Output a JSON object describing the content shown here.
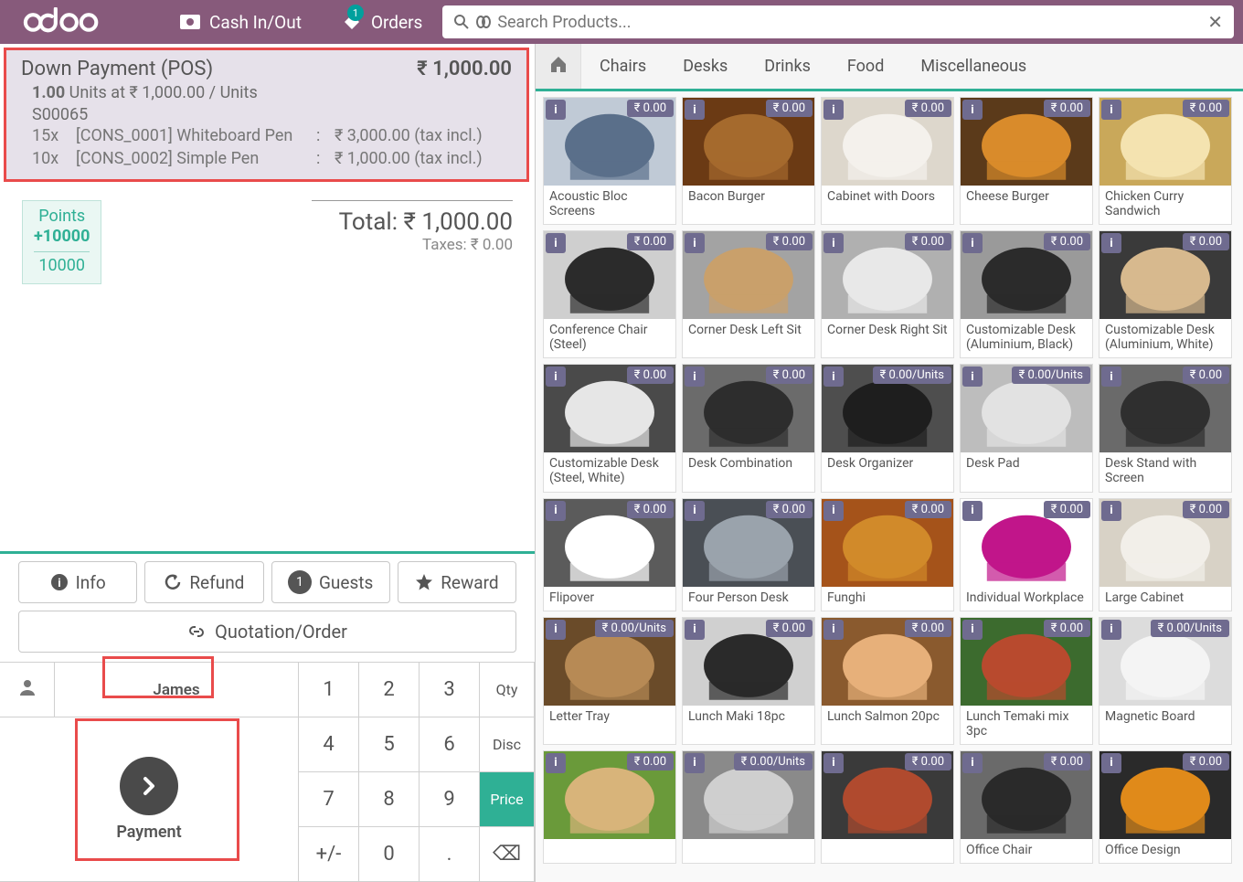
{
  "topbar": {
    "cash": "Cash In/Out",
    "orders": "Orders",
    "orders_badge": "1",
    "search_placeholder": "Search Products...",
    "logo_text": "odoo"
  },
  "order": {
    "product": "Down Payment (POS)",
    "amount": "₹ 1,000.00",
    "qty_line_prefix": "1.00",
    "qty_line_rest": "Units at ₹ 1,000.00 / Units",
    "ref": "S00065",
    "lines": [
      {
        "qty": "15x",
        "name": "[CONS_0001] Whiteboard Pen",
        "colon": ":",
        "val": "₹ 3,000.00 (tax incl.)"
      },
      {
        "qty": "10x",
        "name": "[CONS_0002] Simple Pen",
        "colon": ":",
        "val": "₹ 1,000.00 (tax incl.)"
      }
    ]
  },
  "points": {
    "label": "Points",
    "add": "+10000",
    "total": "10000"
  },
  "totals": {
    "total": "Total: ₹ 1,000.00",
    "taxes": "Taxes: ₹ 0.00"
  },
  "buttons": {
    "info": "Info",
    "refund": "Refund",
    "guests": "Guests",
    "guests_count": "1",
    "reward": "Reward",
    "quotation": "Quotation/Order"
  },
  "pad": {
    "customer": "James",
    "k1": "1",
    "k2": "2",
    "k3": "3",
    "k4": "4",
    "k5": "5",
    "k6": "6",
    "k7": "7",
    "k8": "8",
    "k9": "9",
    "k0": "0",
    "pm": "+/-",
    "dot": ".",
    "bs": "⌫",
    "qty": "Qty",
    "disc": "Disc",
    "price": "Price",
    "payment": "Payment"
  },
  "categories": [
    "Chairs",
    "Desks",
    "Drinks",
    "Food",
    "Miscellaneous"
  ],
  "products": [
    [
      {
        "name": "Acoustic Bloc Screens",
        "price": "₹ 0.00",
        "c1": "#5a6f8a",
        "c2": "#c0cad6"
      },
      {
        "name": "Bacon Burger",
        "price": "₹ 0.00",
        "c1": "#a56a2d",
        "c2": "#6b3a14"
      },
      {
        "name": "Cabinet with Doors",
        "price": "₹ 0.00",
        "c1": "#f4f1ec",
        "c2": "#ddd7cc"
      },
      {
        "name": "Cheese Burger",
        "price": "₹ 0.00",
        "c1": "#d98b2b",
        "c2": "#5b3a1a"
      },
      {
        "name": "Chicken Curry Sandwich",
        "price": "₹ 0.00",
        "c1": "#f4e3b0",
        "c2": "#c9a85a"
      }
    ],
    [
      {
        "name": "Conference Chair (Steel)",
        "price": "₹ 0.00",
        "c1": "#2b2b2b",
        "c2": "#cfcfcf"
      },
      {
        "name": "Corner Desk Left Sit",
        "price": "₹ 0.00",
        "c1": "#c9a06b",
        "c2": "#a3a3a3"
      },
      {
        "name": "Corner Desk Right Sit",
        "price": "₹ 0.00",
        "c1": "#e8e8e8",
        "c2": "#b0b0b0"
      },
      {
        "name": "Customizable Desk (Aluminium, Black)",
        "price": "₹ 0.00",
        "c1": "#2b2b2b",
        "c2": "#9a9a9a"
      },
      {
        "name": "Customizable Desk (Aluminium, White)",
        "price": "₹ 0.00",
        "c1": "#d7b98e",
        "c2": "#3a3a3a"
      }
    ],
    [
      {
        "name": "Customizable Desk (Steel, White)",
        "price": "₹ 0.00",
        "c1": "#e6e6e6",
        "c2": "#4a4a4a"
      },
      {
        "name": "Desk Combination",
        "price": "₹ 0.00",
        "c1": "#2d2d2d",
        "c2": "#6b6b6b"
      },
      {
        "name": "Desk Organizer",
        "price": "₹ 0.00/Units",
        "c1": "#1e1e1e",
        "c2": "#4e4e4e"
      },
      {
        "name": "Desk Pad",
        "price": "₹ 0.00/Units",
        "c1": "#e2e2e2",
        "c2": "#bdbdbd"
      },
      {
        "name": "Desk Stand with Screen",
        "price": "₹ 0.00",
        "c1": "#2f2f2f",
        "c2": "#6a6a6a"
      }
    ],
    [
      {
        "name": "Flipover",
        "price": "₹ 0.00",
        "c1": "#ffffff",
        "c2": "#5b5b5b"
      },
      {
        "name": "Four Person Desk",
        "price": "₹ 0.00",
        "c1": "#9aa3ac",
        "c2": "#4a4f55"
      },
      {
        "name": "Funghi",
        "price": "₹ 0.00",
        "c1": "#d18a2a",
        "c2": "#a5531a"
      },
      {
        "name": "Individual Workplace",
        "price": "₹ 0.00",
        "c1": "#c1158a",
        "c2": "#ffffff"
      },
      {
        "name": "Large Cabinet",
        "price": "₹ 0.00",
        "c1": "#f2efe9",
        "c2": "#d8d2c6"
      }
    ],
    [
      {
        "name": "Letter Tray",
        "price": "₹ 0.00/Units",
        "c1": "#b78a55",
        "c2": "#6a4b29"
      },
      {
        "name": "Lunch Maki 18pc",
        "price": "₹ 0.00",
        "c1": "#2a2a2a",
        "c2": "#d0d0d0"
      },
      {
        "name": "Lunch Salmon 20pc",
        "price": "₹ 0.00",
        "c1": "#e7b07a",
        "c2": "#8a5a2e"
      },
      {
        "name": "Lunch Temaki mix 3pc",
        "price": "₹ 0.00",
        "c1": "#b84a2e",
        "c2": "#3c6b2e"
      },
      {
        "name": "Magnetic Board",
        "price": "₹ 0.00/Units",
        "c1": "#f4f4f4",
        "c2": "#dcdcdc"
      }
    ],
    [
      {
        "name": "",
        "price": "₹ 0.00",
        "c1": "#d8b47a",
        "c2": "#6a9a3a"
      },
      {
        "name": "",
        "price": "₹ 0.00/Units",
        "c1": "#cfcfcf",
        "c2": "#8a8a8a"
      },
      {
        "name": "",
        "price": "₹ 0.00",
        "c1": "#b04a2e",
        "c2": "#3a3a3a"
      },
      {
        "name": "Office Chair",
        "price": "₹ 0.00",
        "c1": "#2a2a2a",
        "c2": "#6a6a6a"
      },
      {
        "name": "Office Design",
        "price": "₹ 0.00",
        "c1": "#e08a1a",
        "c2": "#2a2a2a"
      }
    ]
  ]
}
